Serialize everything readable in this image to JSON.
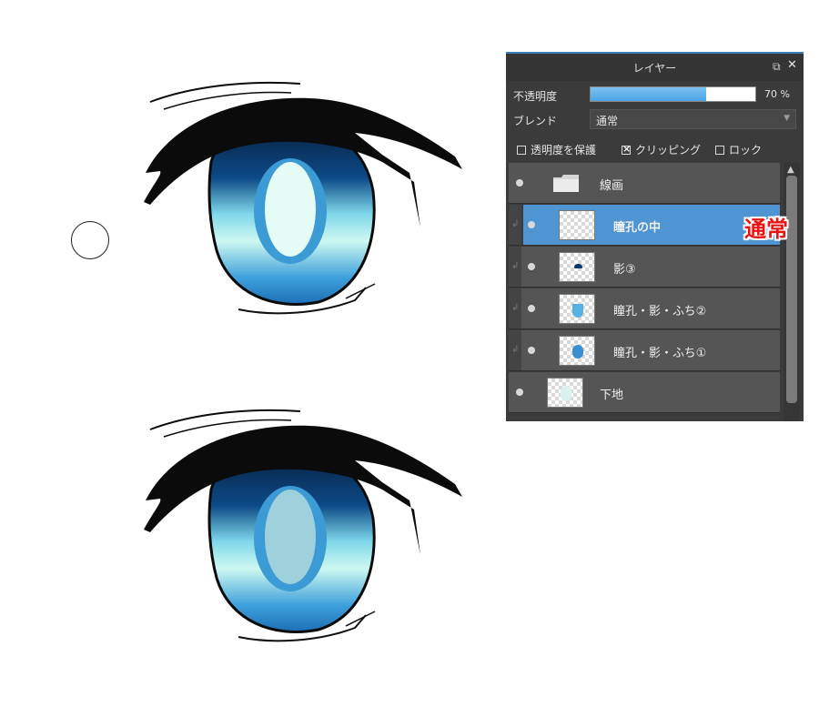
{
  "canvas": {
    "colors": {
      "lash": "#0b0b0b",
      "iris_dark": "#0a2d5a",
      "iris_mid": "#2e7fc1",
      "iris_light": "#bff4ef",
      "pupil_ring": "#3c9ad4",
      "highlight": "#e5fbf5",
      "highlight_dim": "#9ed1dc"
    }
  },
  "layer_panel": {
    "title": "レイヤー",
    "icons": {
      "popout": "popout-icon",
      "close": "close-icon"
    },
    "opacity": {
      "label": "不透明度",
      "value": 0.7,
      "text": "70 %"
    },
    "blend": {
      "label": "ブレンド",
      "value": "通常"
    },
    "options": {
      "protect_alpha": "透明度を保護",
      "clipping": "クリッピング",
      "lock": "ロック"
    },
    "layers": [
      {
        "name": "線画",
        "type": "folder"
      },
      {
        "name": "瞳孔の中",
        "selected": true,
        "clipped": true
      },
      {
        "name": "影③",
        "clipped": true
      },
      {
        "name": "瞳孔・影・ふち②",
        "clipped": true
      },
      {
        "name": "瞳孔・影・ふち①",
        "clipped": true
      },
      {
        "name": "下地"
      }
    ]
  },
  "callout": {
    "text": "通常"
  }
}
